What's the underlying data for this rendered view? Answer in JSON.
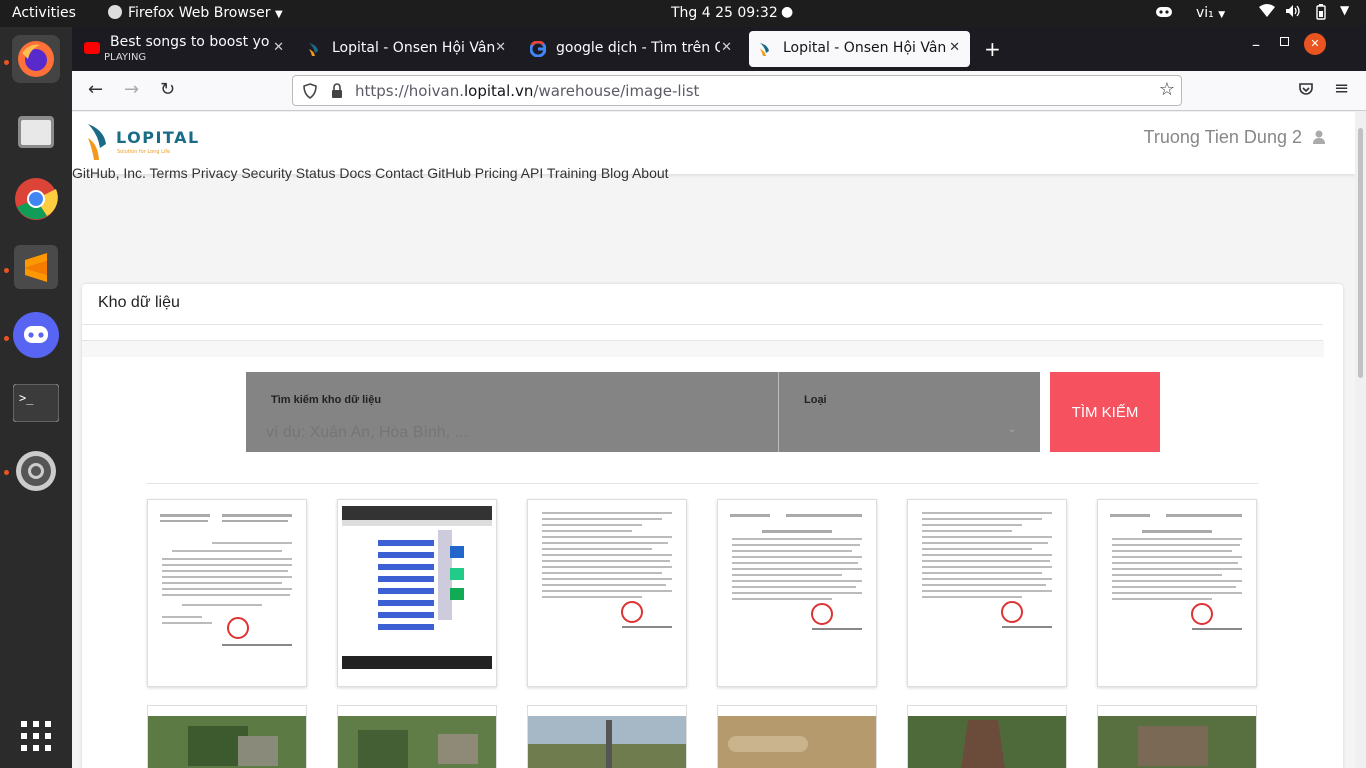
{
  "topbar": {
    "activities": "Activities",
    "app": "Firefox Web Browser",
    "datetime": "Thg 4 25  09:32",
    "lang": "vi₁"
  },
  "dock": {
    "items": [
      "firefox-icon",
      "files-icon",
      "chrome-icon",
      "sublime-icon",
      "discord-icon",
      "terminal-icon",
      "settings-icon",
      "apps-grid-icon"
    ]
  },
  "browser": {
    "tabs": [
      {
        "title": "Best songs to boost your",
        "sub": "PLAYING"
      },
      {
        "title": "Lopital - Onsen Hội Vân"
      },
      {
        "title": "google dịch - Tìm trên Go"
      },
      {
        "title": "Lopital - Onsen Hội Vân"
      }
    ],
    "url_prefix": "https://hoivan.",
    "url_domain": "lopital.vn",
    "url_path": "/warehouse/image-list",
    "close_glyph": "✕",
    "new_tab_glyph": "+"
  },
  "page": {
    "logo_text": "LOPITAL",
    "logo_sub": "Solution for Long Life",
    "user_name": "Truong Tien Dung 2",
    "footer_links": "GitHub, Inc. Terms Privacy Security Status Docs Contact GitHub Pricing API Training Blog About",
    "card_title": "Kho dữ liệu",
    "search_label": "Tìm kiếm kho dữ liệu",
    "search_placeholder": "ví dụ: Xuân An, Hòa Bình, ...",
    "type_label": "Loại",
    "search_button": "TÌM KIẾM"
  },
  "colors": {
    "accent": "#f5515f",
    "search_bg": "#848484",
    "logo_teal": "#1a6b86",
    "logo_orange": "#f39a1e"
  }
}
